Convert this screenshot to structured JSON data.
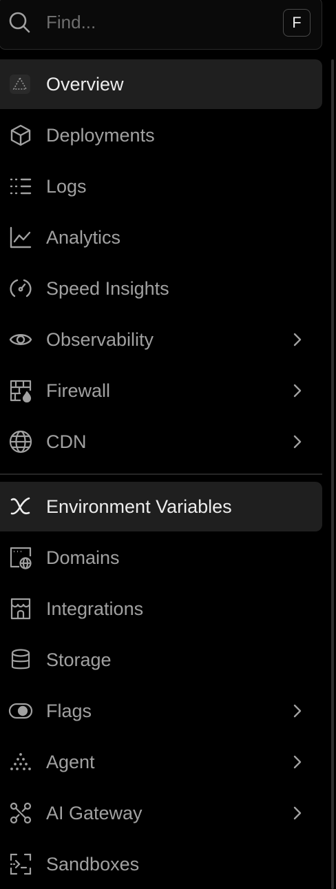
{
  "search": {
    "placeholder": "Find...",
    "shortcut": "F"
  },
  "nav": {
    "overview": "Overview",
    "deployments": "Deployments",
    "logs": "Logs",
    "analytics": "Analytics",
    "speed_insights": "Speed Insights",
    "observability": "Observability",
    "firewall": "Firewall",
    "cdn": "CDN",
    "environment_variables": "Environment Variables",
    "domains": "Domains",
    "integrations": "Integrations",
    "storage": "Storage",
    "flags": "Flags",
    "agent": "Agent",
    "ai_gateway": "AI Gateway",
    "sandboxes": "Sandboxes"
  },
  "icons": {
    "search": "search-icon",
    "overview": "triangle-icon",
    "deployments": "cube-icon",
    "logs": "list-icon",
    "analytics": "line-chart-icon",
    "speed_insights": "gauge-icon",
    "observability": "eye-icon",
    "firewall": "brick-wall-flame-icon",
    "cdn": "globe-icon",
    "environment_variables": "variable-x-icon",
    "domains": "browser-globe-icon",
    "integrations": "storefront-icon",
    "storage": "database-icon",
    "flags": "toggle-icon",
    "agent": "dots-triangle-icon",
    "ai_gateway": "nodes-icon",
    "sandboxes": "terminal-bracket-icon",
    "submenu": "chevron-right-icon"
  },
  "colors": {
    "background": "#000000",
    "active_background": "#1f1f1f",
    "text": "#a1a1a1",
    "active_text": "#ededed"
  }
}
